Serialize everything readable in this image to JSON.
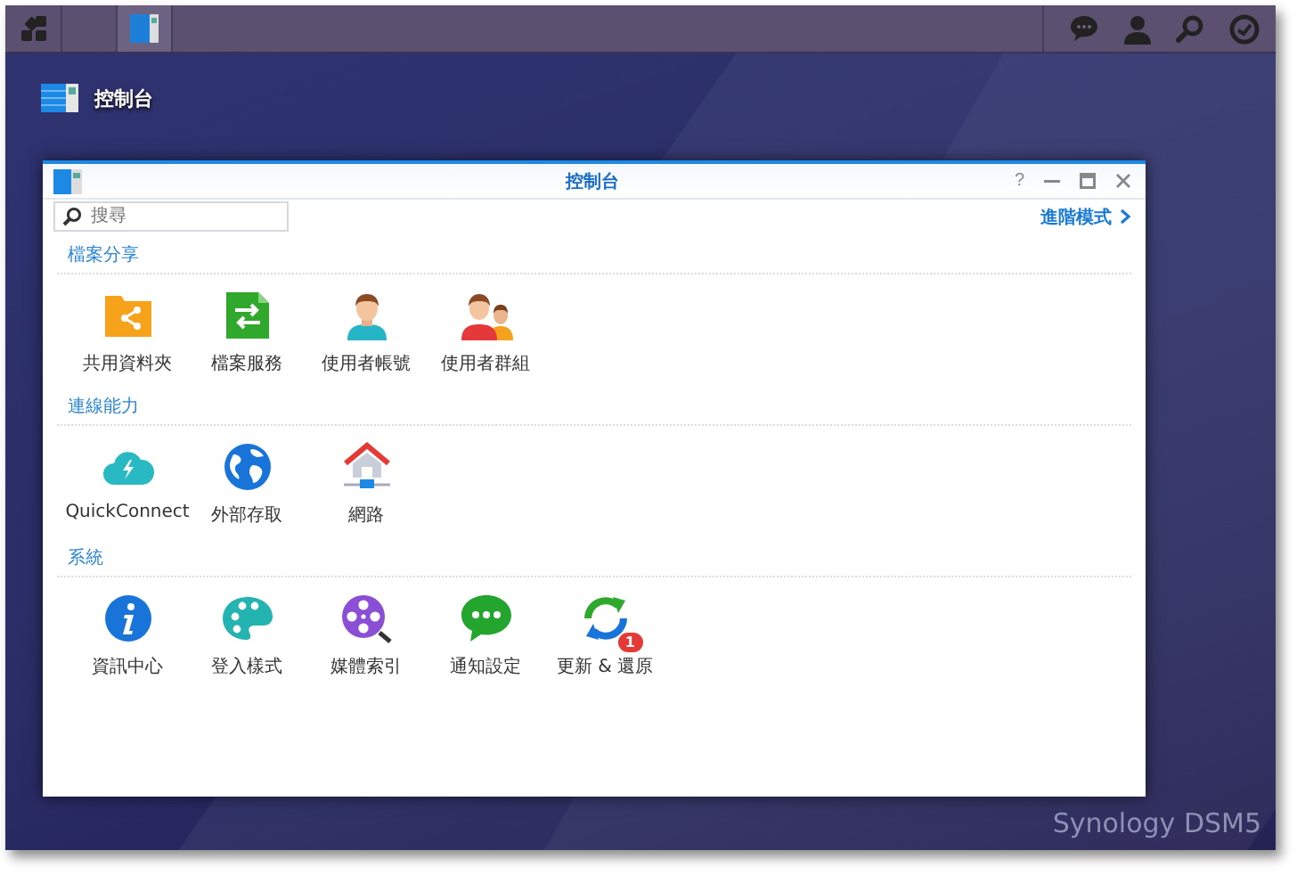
{
  "taskbar": {
    "buttons": [
      {
        "kind": "apps",
        "selected": false
      },
      {
        "kind": "control-panel",
        "selected": true
      }
    ],
    "tray": [
      {
        "kind": "chat"
      },
      {
        "kind": "user"
      },
      {
        "kind": "search"
      },
      {
        "kind": "widgets"
      }
    ]
  },
  "desktop": {
    "shortcuts": [
      {
        "label": "控制台"
      }
    ],
    "brand": "Synology",
    "brand_version": "DSM5"
  },
  "window": {
    "title": "控制台",
    "help": "?",
    "search": {
      "placeholder": "搜尋"
    },
    "mode_link": "進階模式",
    "sections": [
      {
        "title": "檔案分享",
        "items": [
          {
            "label": "共用資料夾",
            "kind": "folder"
          },
          {
            "label": "檔案服務",
            "kind": "file"
          },
          {
            "label": "使用者帳號",
            "kind": "user"
          },
          {
            "label": "使用者群組",
            "kind": "group"
          }
        ]
      },
      {
        "title": "連線能力",
        "items": [
          {
            "label": "QuickConnect",
            "kind": "cloud"
          },
          {
            "label": "外部存取",
            "kind": "globe"
          },
          {
            "label": "網路",
            "kind": "house"
          }
        ]
      },
      {
        "title": "系統",
        "items": [
          {
            "label": "資訊中心",
            "kind": "info"
          },
          {
            "label": "登入樣式",
            "kind": "palette"
          },
          {
            "label": "媒體索引",
            "kind": "film"
          },
          {
            "label": "通知設定",
            "kind": "chat"
          },
          {
            "label": "更新 & 還原",
            "kind": "refresh",
            "badge": "1"
          }
        ]
      }
    ]
  }
}
